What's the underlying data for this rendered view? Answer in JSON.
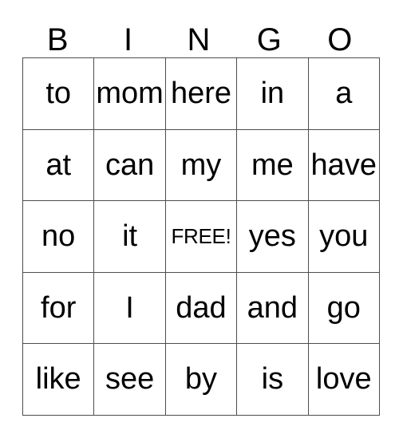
{
  "card": {
    "title": "BINGO",
    "header_letters": [
      "B",
      "I",
      "N",
      "G",
      "O"
    ],
    "free_space_label": "FREE!",
    "free_space_position": {
      "row": 2,
      "col": 2
    },
    "grid_rows": 5,
    "grid_cols": 5,
    "border_color": "#4d4d4d",
    "text_color": "#000000",
    "background_color": "#ffffff",
    "rows": [
      {
        "cells": [
          "to",
          "mom",
          "here",
          "in",
          "a"
        ]
      },
      {
        "cells": [
          "at",
          "can",
          "my",
          "me",
          "have"
        ]
      },
      {
        "cells": [
          "no",
          "it",
          "FREE!",
          "yes",
          "you"
        ]
      },
      {
        "cells": [
          "for",
          "I",
          "dad",
          "and",
          "go"
        ]
      },
      {
        "cells": [
          "like",
          "see",
          "by",
          "is",
          "love"
        ]
      }
    ]
  }
}
